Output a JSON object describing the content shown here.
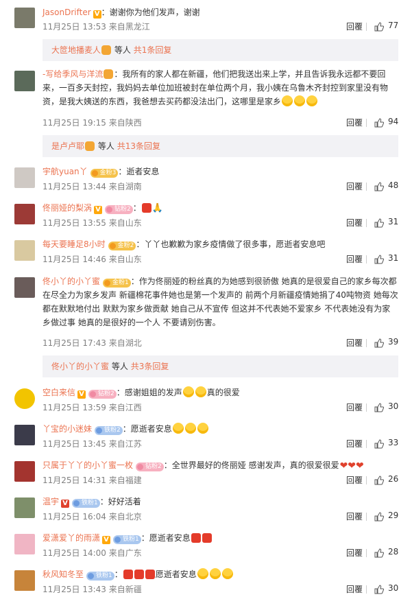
{
  "comments": [
    {
      "user": "JasonDrifter",
      "badge": "V",
      "text": "：谢谢你为他们发声，谢谢",
      "time": "11月25日 13:53 来自黑龙江",
      "likes": "77",
      "avatar": "#7a7a6a"
    },
    {
      "user": "-写给季风与洋流",
      "text": "：我所有的家人都在新疆，他们把我送出来上学，并且告诉我永远都不要回来，一百多天封控，我妈妈去单位加班被封在单位两个月，我小姨在乌鲁木齐封控到家里没有物资，是我大姨送的东西，我爸想去买药都没法出门，这哪里是家乡",
      "time": "11月25日 19:15 来自陕西",
      "likes": "94",
      "avatar": "#5b6a5a"
    },
    {
      "user": "宇航yuan丫",
      "fan": "金粉3",
      "text": "：逝者安息",
      "time": "11月25日 13:44 来自湖南",
      "likes": "48",
      "avatar": "#cfc9c4"
    },
    {
      "user": "佟丽娅的梨涡",
      "badge": "V",
      "fan": "钻粉2",
      "text": "：",
      "time": "11月25日 13:55 来自山东",
      "likes": "31",
      "avatar": "#9c3a36"
    },
    {
      "user": "每天要睡足8小时",
      "fan": "金粉2",
      "text": "：丫丫也歉歉为家乡疫情做了很多事，愿逝者安息吧",
      "time": "11月25日 14:46 来自山东",
      "likes": "31",
      "avatar": "#d9c9a0"
    },
    {
      "user": "佟小丫的小丫蜜",
      "fan": "金粉1",
      "text": "：作为佟丽娅的粉丝真的为她感到很骄傲 她真的是很爱自己的家乡每次都在尽全力为家乡发声 新疆棉花事件她也是第一个发声的 前两个月新疆疫情她捐了40吨物资 她每次都在默默地付出 默默为家乡做贡献 她自己从不宣传 但这并不代表她不爱家乡 不代表她没有为家乡做过事 她真的是很好的一个人 不要请别伤害。",
      "time": "11月25日 17:43 来自湖北",
      "likes": "39",
      "avatar": "#6a5c5a"
    },
    {
      "user": "空白来信",
      "badge": "V",
      "fan": "钻粉2",
      "text": "：感谢姐姐的发声",
      "text2": "真的很爱",
      "time": "11月25日 13:59 来自江西",
      "likes": "30",
      "avatar": "#f2c400"
    },
    {
      "user": "丫宝的小迷妹",
      "fan": "铁粉2",
      "text": "：愿逝者安息",
      "time": "11月25日 13:45 来自江苏",
      "likes": "33",
      "avatar": "#3b3b4a"
    },
    {
      "user": "只属于丫丫的小丫蜜一枚",
      "fan": "钻粉2",
      "text": "：全世界最好的佟丽娅 感谢发声，真的很爱很爱",
      "time": "11月25日 14:31 来自福建",
      "likes": "26",
      "avatar": "#a3342f"
    },
    {
      "user": "温宇",
      "badge": "V",
      "fan": "铁粉1",
      "text": "：好好活着",
      "time": "11月25日 16:04 来自北京",
      "likes": "29",
      "avatar": "#7e8f6a"
    },
    {
      "user": "爱潇爱丫的雨潇",
      "badge": "V",
      "fan": "铁粉1",
      "text": "：愿逝者安息",
      "time": "11月25日 14:00 来自广东",
      "likes": "28",
      "avatar": "#f0b5c4"
    },
    {
      "user": "秋风知冬至",
      "fan": "铁粉1",
      "text": "：",
      "text2": "愿逝者安息",
      "time": "11月25日 13:43 来自新疆",
      "likes": "30",
      "avatar": "#c7843a"
    }
  ],
  "sub_replies": [
    {
      "user": "大笸地播麦人",
      "suffix": "等人",
      "count": "共1条回复"
    },
    {
      "user": "是卢卢耶",
      "suffix": "等人",
      "count": "共13条回复"
    },
    {
      "user": "佟小丫的小丫蜜",
      "suffix": "等人",
      "count": "共3条回复"
    }
  ],
  "reply_label": "回覆",
  "colors": {
    "username": "#eb7350",
    "meta": "#808080",
    "subbox": "#f2f2f5"
  }
}
